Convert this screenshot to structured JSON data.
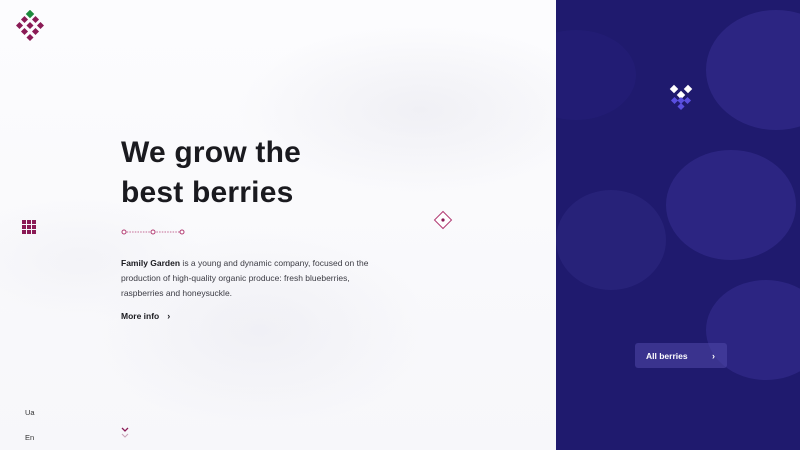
{
  "brand": {
    "logo_icon": "berry-cluster-logo",
    "primary_color": "#8a1a55",
    "accent_color": "#1f1a6e",
    "leaf_color": "#1d8a3c"
  },
  "nav": {
    "menu_icon": "grid-menu-icon",
    "languages": [
      "Ua",
      "En"
    ]
  },
  "hero": {
    "title_line1": "We grow the",
    "title_line2": "best berries",
    "company": "Family Garden",
    "description": " is a young and dynamic company, focused on the production of high-quality organic produce: fresh blueberries, raspberries and honeysuckle.",
    "more_info_label": "More info"
  },
  "side": {
    "all_berries_label": "All berries"
  }
}
